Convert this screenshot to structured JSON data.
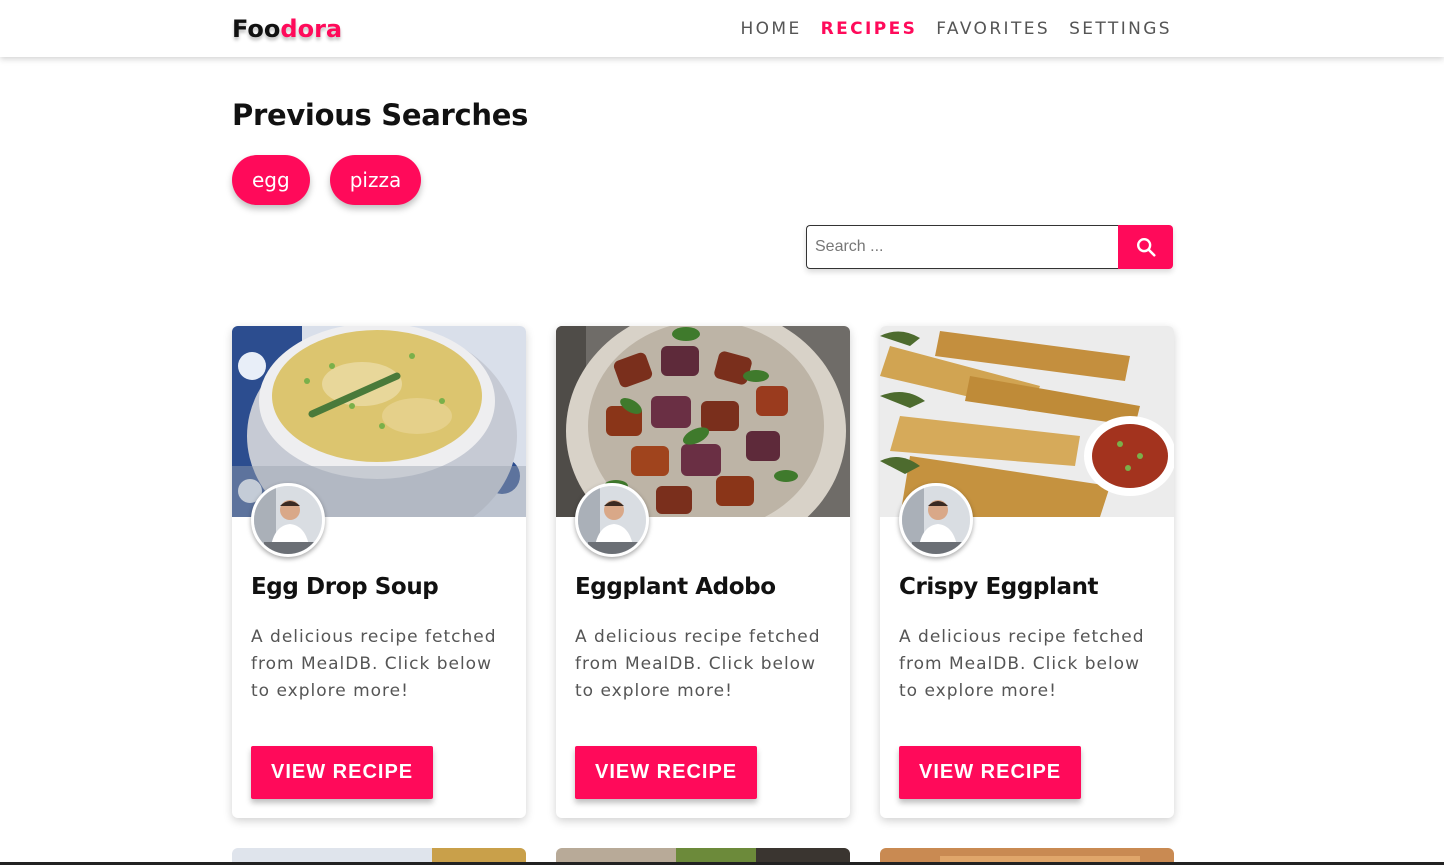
{
  "brand": {
    "part1": "Foo",
    "part2": "dora"
  },
  "nav": [
    {
      "label": "HOME",
      "active": false
    },
    {
      "label": "RECIPES",
      "active": true
    },
    {
      "label": "FAVORITES",
      "active": false
    },
    {
      "label": "SETTINGS",
      "active": false
    }
  ],
  "previous_searches": {
    "title": "Previous Searches",
    "chips": [
      "egg",
      "pizza"
    ]
  },
  "search": {
    "placeholder": "Search ...",
    "value": ""
  },
  "cards": [
    {
      "title": "Egg Drop Soup",
      "description": "A delicious recipe fetched from MealDB. Click below to explore more!",
      "button": "VIEW RECIPE"
    },
    {
      "title": "Eggplant Adobo",
      "description": "A delicious recipe fetched from MealDB. Click below to explore more!",
      "button": "VIEW RECIPE"
    },
    {
      "title": "Crispy Eggplant",
      "description": "A delicious recipe fetched from MealDB. Click below to explore more!",
      "button": "VIEW RECIPE"
    }
  ],
  "colors": {
    "accent": "#ff0a5a",
    "text": "#111111",
    "muted": "#555555"
  }
}
